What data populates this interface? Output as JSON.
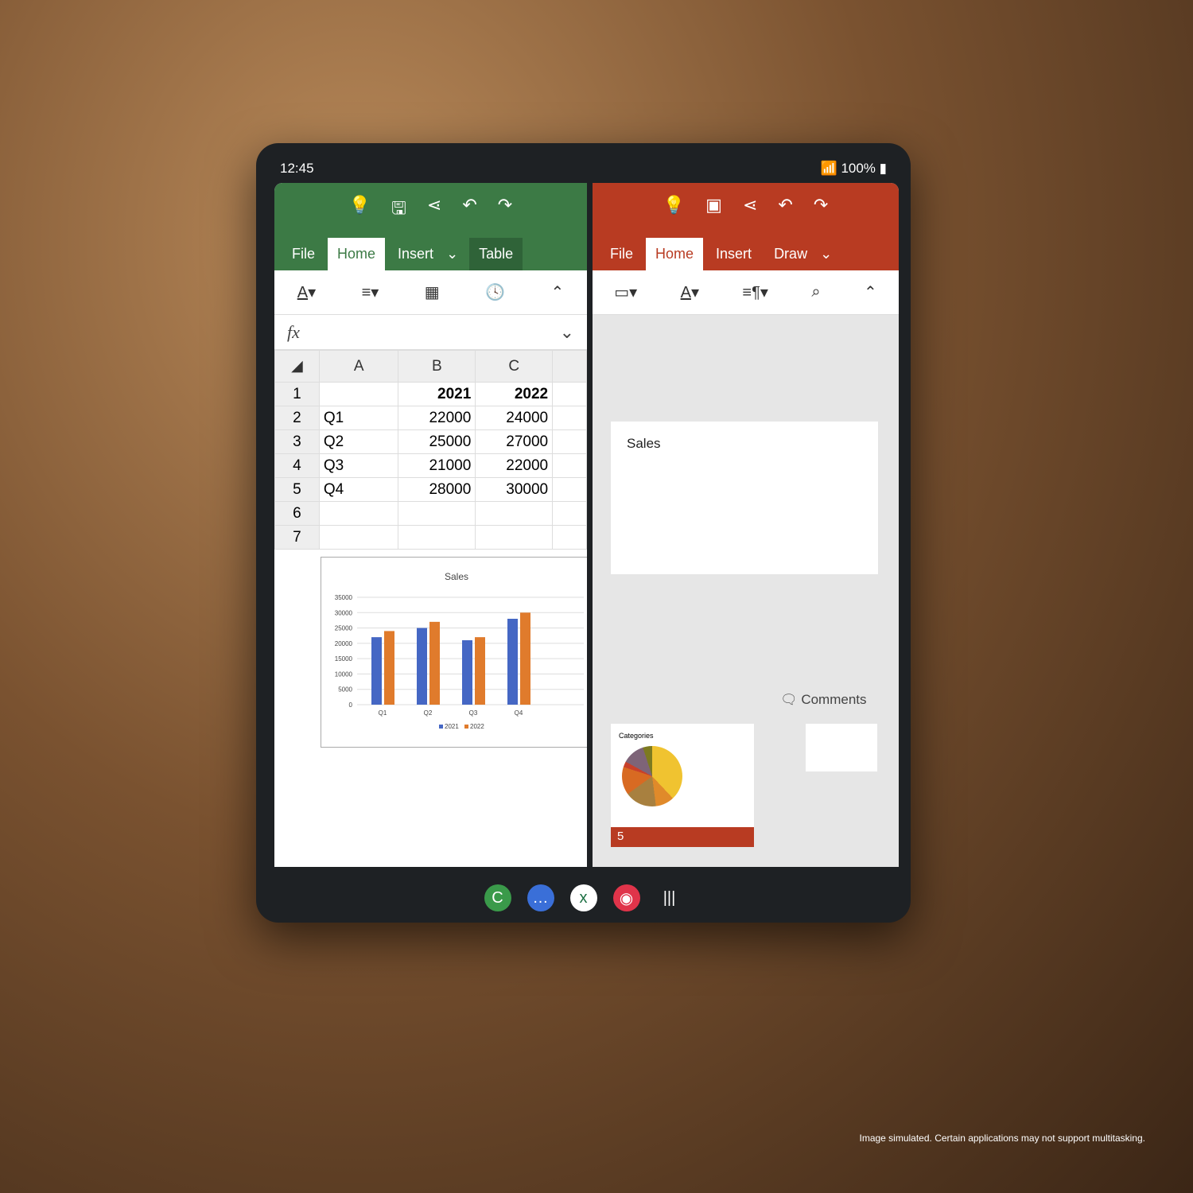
{
  "status": {
    "time": "12:45",
    "battery": "100%"
  },
  "excel": {
    "tabs": [
      "File",
      "Home",
      "Insert",
      "Table"
    ],
    "active_tab": "Home",
    "fx": "fx",
    "columns": [
      "A",
      "B",
      "C"
    ],
    "rows": [
      [
        "1",
        "",
        "2021",
        "2022"
      ],
      [
        "2",
        "Q1",
        "22000",
        "24000"
      ],
      [
        "3",
        "Q2",
        "25000",
        "27000"
      ],
      [
        "4",
        "Q3",
        "21000",
        "22000"
      ],
      [
        "5",
        "Q4",
        "28000",
        "30000"
      ],
      [
        "6",
        "",
        "",
        ""
      ],
      [
        "7",
        "",
        "",
        ""
      ]
    ]
  },
  "chart_data": {
    "type": "bar",
    "title": "Sales",
    "categories": [
      "Q1",
      "Q2",
      "Q3",
      "Q4"
    ],
    "series": [
      {
        "name": "2021",
        "values": [
          22000,
          25000,
          21000,
          28000
        ],
        "color": "#4567c4"
      },
      {
        "name": "2022",
        "values": [
          24000,
          27000,
          22000,
          30000
        ],
        "color": "#e07b2c"
      }
    ],
    "yticks": [
      0,
      5000,
      10000,
      15000,
      20000,
      25000,
      30000,
      35000
    ],
    "ylim": [
      0,
      35000
    ],
    "grid": true,
    "legend": "bottom"
  },
  "powerpoint": {
    "tabs": [
      "File",
      "Home",
      "Insert",
      "Draw"
    ],
    "active_tab": "Home",
    "slide_title": "Sales",
    "comments": "Comments",
    "thumb_title": "Categories",
    "thumb_number": "5"
  },
  "colors": {
    "excel": "#3c7a45",
    "powerpoint": "#b83b22"
  },
  "disclaimer": "Image simulated. Certain applications may not support multitasking."
}
